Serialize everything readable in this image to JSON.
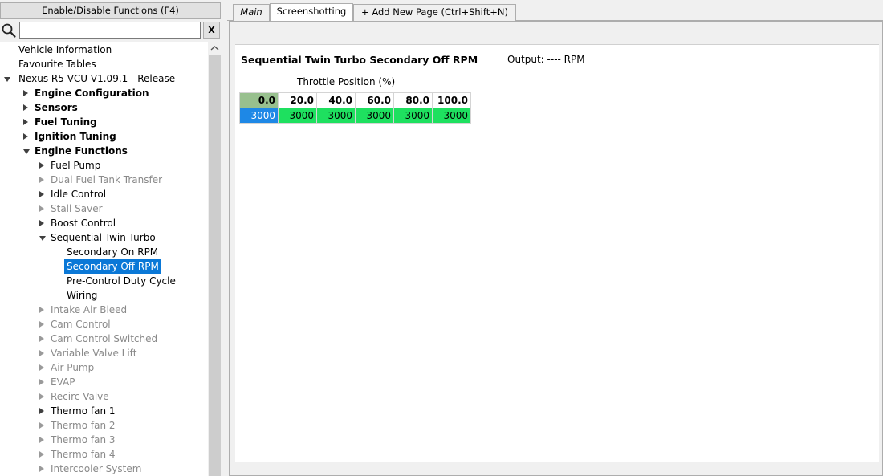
{
  "left_panel": {
    "toggle_label": "Enable/Disable Functions (F4)",
    "search": {
      "value": "",
      "placeholder": ""
    },
    "clear_label": "X"
  },
  "tree": [
    {
      "label": "Vehicle Information",
      "style": "normal",
      "arrow": "none"
    },
    {
      "label": "Favourite Tables",
      "style": "normal",
      "arrow": "none"
    },
    {
      "label": "Nexus R5 VCU V1.09.1 - Release",
      "style": "normal",
      "arrow": "down"
    },
    {
      "label": "Engine Configuration",
      "style": "bold",
      "arrow": "right"
    },
    {
      "label": "Sensors",
      "style": "bold",
      "arrow": "right"
    },
    {
      "label": "Fuel Tuning",
      "style": "bold",
      "arrow": "right"
    },
    {
      "label": "Ignition Tuning",
      "style": "bold",
      "arrow": "right"
    },
    {
      "label": "Engine Functions",
      "style": "bold",
      "arrow": "down"
    },
    {
      "label": "Fuel Pump",
      "style": "normal",
      "arrow": "right"
    },
    {
      "label": "Dual Fuel Tank Transfer",
      "style": "dim",
      "arrow": "right"
    },
    {
      "label": "Idle Control",
      "style": "normal",
      "arrow": "right"
    },
    {
      "label": "Stall Saver",
      "style": "dim",
      "arrow": "right"
    },
    {
      "label": "Boost Control",
      "style": "normal",
      "arrow": "right"
    },
    {
      "label": "Sequential Twin Turbo",
      "style": "normal",
      "arrow": "down"
    },
    {
      "label": "Secondary On RPM",
      "style": "normal",
      "arrow": "none"
    },
    {
      "label": "Secondary Off RPM",
      "style": "selected",
      "arrow": "none"
    },
    {
      "label": "Pre-Control Duty Cycle",
      "style": "normal",
      "arrow": "none"
    },
    {
      "label": "Wiring",
      "style": "normal",
      "arrow": "none"
    },
    {
      "label": "Intake Air Bleed",
      "style": "dim",
      "arrow": "right"
    },
    {
      "label": "Cam Control",
      "style": "dim",
      "arrow": "right"
    },
    {
      "label": "Cam Control Switched",
      "style": "dim",
      "arrow": "right"
    },
    {
      "label": "Variable Valve Lift",
      "style": "dim",
      "arrow": "right"
    },
    {
      "label": "Air Pump",
      "style": "dim",
      "arrow": "right"
    },
    {
      "label": "EVAP",
      "style": "dim",
      "arrow": "right"
    },
    {
      "label": "Recirc Valve",
      "style": "dim",
      "arrow": "right"
    },
    {
      "label": "Thermo fan 1",
      "style": "normal",
      "arrow": "right"
    },
    {
      "label": "Thermo fan 2",
      "style": "dim",
      "arrow": "right"
    },
    {
      "label": "Thermo fan 3",
      "style": "dim",
      "arrow": "right"
    },
    {
      "label": "Thermo fan 4",
      "style": "dim",
      "arrow": "right"
    },
    {
      "label": "Intercooler System",
      "style": "dim",
      "arrow": "right"
    }
  ],
  "tabs": [
    {
      "label": "Main",
      "active": false
    },
    {
      "label": "Screenshotting",
      "active": true
    },
    {
      "label": "+ Add New Page (Ctrl+Shift+N)",
      "active": false
    }
  ],
  "table": {
    "title": "Sequential Twin Turbo Secondary Off RPM",
    "output": "Output: ---- RPM",
    "axis_label": "Throttle Position (%)",
    "columns": [
      "0.0",
      "20.0",
      "40.0",
      "60.0",
      "80.0",
      "100.0"
    ],
    "values": [
      "3000",
      "3000",
      "3000",
      "3000",
      "3000",
      "3000"
    ]
  },
  "colors": {
    "selection": "#0a78d7",
    "header_first_cell": "#98c08e",
    "value_cell": "#1ee05f",
    "value_first_cell": "#1e88e6"
  }
}
